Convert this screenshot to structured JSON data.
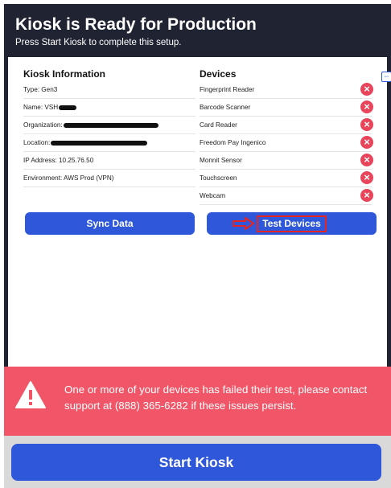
{
  "header": {
    "title": "Kiosk is Ready for Production",
    "subtitle": "Press Start Kiosk to complete this setup."
  },
  "kiosk_info": {
    "heading": "Kiosk Information",
    "rows": [
      {
        "label": "Type: Gen3"
      },
      {
        "label": "Name: VSH"
      },
      {
        "label": "Organization:"
      },
      {
        "label": "Location:"
      },
      {
        "label": "IP Address: 10.25.76.50"
      },
      {
        "label": "Environment: AWS Prod (VPN)"
      }
    ]
  },
  "devices": {
    "heading": "Devices",
    "items": [
      {
        "name": "Fingerprint Reader",
        "status": "failed"
      },
      {
        "name": "Barcode Scanner",
        "status": "failed"
      },
      {
        "name": "Card Reader",
        "status": "failed"
      },
      {
        "name": "Freedom Pay Ingenico",
        "status": "failed"
      },
      {
        "name": "Monnit Sensor",
        "status": "failed"
      },
      {
        "name": "Touchscreen",
        "status": "failed"
      },
      {
        "name": "Webcam",
        "status": "failed"
      }
    ]
  },
  "buttons": {
    "sync": "Sync Data",
    "test": "Test Devices",
    "start": "Start Kiosk"
  },
  "alert": {
    "message": "One or more of your devices has failed their test, please contact support at (888) 365-6282 if these issues persist."
  },
  "colors": {
    "header_bg": "#202331",
    "button_blue": "#2f57d9",
    "fail_red": "#e8445a",
    "alert_bg": "#f05667",
    "footer_bg": "#d9d9d9"
  }
}
